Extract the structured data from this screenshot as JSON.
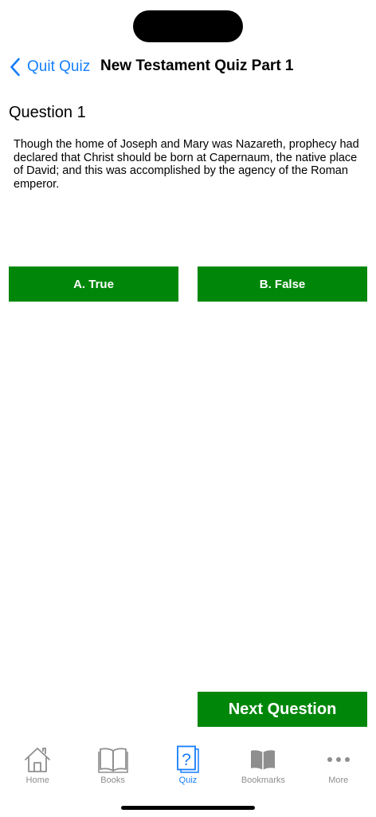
{
  "nav": {
    "back_label": "Quit Quiz",
    "title": "New Testament Quiz Part 1"
  },
  "question": {
    "heading": "Question 1",
    "text": "Though the home of Joseph and Mary was Nazareth, prophecy had declared that Christ should be born at Capernaum, the native place of David; and this was accomplished by the agency of the Roman emperor."
  },
  "answers": {
    "a_label": "A. True",
    "b_label": "B. False"
  },
  "next_label": "Next Question",
  "tabbar": {
    "items": [
      {
        "label": "Home",
        "icon": "home-icon"
      },
      {
        "label": "Books",
        "icon": "book-icon"
      },
      {
        "label": "Quiz",
        "icon": "quiz-icon"
      },
      {
        "label": "Bookmarks",
        "icon": "bookmarks-icon"
      },
      {
        "label": "More",
        "icon": "more-icon"
      }
    ],
    "active": "Quiz"
  },
  "colors": {
    "accent": "#147efb",
    "button_green": "#00870a",
    "inactive_gray": "#8e8e8e"
  }
}
